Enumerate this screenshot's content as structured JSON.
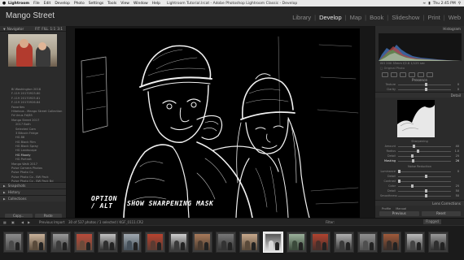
{
  "menubar": {
    "apple": "",
    "app_name": "Lightroom",
    "items": [
      "File",
      "Edit",
      "Develop",
      "Photo",
      "Settings",
      "Tools",
      "View",
      "Window",
      "Help"
    ],
    "window_title": "Lightroom Tutorial.lrcat - Adobe Photoshop Lightroom Classic - Develop",
    "clock": "Thu 2:45 PM"
  },
  "identity_plate": "Mango Street",
  "modules": {
    "items": [
      "Library",
      "Develop",
      "Map",
      "Book",
      "Slideshow",
      "Print",
      "Web"
    ],
    "active": "Develop"
  },
  "left_panel": {
    "navigator_title": "Navigator",
    "navigator_zoom": [
      "FIT",
      "FILL",
      "1:1",
      "3:1"
    ],
    "folders": [
      {
        "label": "Bl Washington 2018",
        "sub": false
      },
      {
        "label": "F-119 20170923.80",
        "sub": false
      },
      {
        "label": "F-119 20170925.81",
        "sub": false
      },
      {
        "label": "F-119 20170926.84",
        "sub": false
      },
      {
        "label": "Favorites",
        "sub": false
      },
      {
        "label": "Hilarious - Mango Street Collection",
        "sub": false
      },
      {
        "label": "Fd Unus Fd/85",
        "sub": false
      },
      {
        "label": "Mango Street 2017",
        "sub": false
      },
      {
        "label": "2017 Both",
        "sub": true
      },
      {
        "label": "Selected Cam",
        "sub": true
      },
      {
        "label": "3 Bitcoin Fridge",
        "sub": true
      },
      {
        "label": "HG 88",
        "sub": true
      },
      {
        "label": "HG Black Film",
        "sub": true
      },
      {
        "label": "HG Black Spray",
        "sub": true
      },
      {
        "label": "HG Landscape",
        "sub": true
      },
      {
        "label": "HG Moody",
        "sub": true,
        "selected": true
      },
      {
        "label": "HG Portrait",
        "sub": true
      },
      {
        "label": "Mango Walk 2017",
        "sub": false
      },
      {
        "label": "Pulse Camera Photos",
        "sub": false
      },
      {
        "label": "Pulse Photo Co",
        "sub": false
      },
      {
        "label": "Pulse Photo Co - BW Pack",
        "sub": false
      },
      {
        "label": "Pulse Photo Co - BW Pack Bd",
        "sub": false
      },
      {
        "label": "",
        "sub": false
      },
      {
        "label": "Color Palette",
        "sub": false
      }
    ],
    "sections": [
      "Snapshots",
      "History",
      "Collections"
    ],
    "buttons": [
      "Copy...",
      "Paste"
    ]
  },
  "overlay": {
    "option_line1": "OPTION",
    "option_line2": "/ ALT",
    "caption": "SHOW SHARPENING MASK"
  },
  "right_panel": {
    "histogram_title": "Histogram",
    "histogram_info": "ISO 200   35mm   f/2.8   1/125 sec",
    "original_photo": "Original Photo",
    "section_presence": "Presence",
    "texture_sliders": [
      {
        "label": "Texture",
        "value": "0"
      },
      {
        "label": "Clarity",
        "value": "0"
      }
    ],
    "detail_title": "Detail",
    "sharpening_title": "Sharpening",
    "sharpening_sliders": [
      {
        "label": "Amount",
        "value": "40",
        "level": 0.27
      },
      {
        "label": "Radius",
        "value": "1.0",
        "level": 0.35
      },
      {
        "label": "Detail",
        "value": "25",
        "level": 0.25
      },
      {
        "label": "Masking",
        "value": "26",
        "level": 0.26,
        "highlight": true
      }
    ],
    "noise_title": "Noise Reduction",
    "noise_sliders": [
      {
        "label": "Luminance",
        "value": "0",
        "level": 0.0
      },
      {
        "label": "Detail",
        "value": "",
        "level": 0.5
      },
      {
        "label": "Contrast",
        "value": "",
        "level": 0.0
      },
      {
        "label": "Color",
        "value": "25",
        "level": 0.25
      },
      {
        "label": "Detail",
        "value": "50",
        "level": 0.5
      },
      {
        "label": "Smoothness",
        "value": "50",
        "level": 0.5
      }
    ],
    "lens_title": "Lens Corrections",
    "profile_tabs": [
      "Profile",
      "Manual"
    ],
    "buttons": [
      "Previous",
      "Reset"
    ]
  },
  "toolbar": {
    "left_text": "Previous Import",
    "count_text": "30 of 537 photos / 1 selected / KGF_0111.CR2",
    "filter_label": "Filter:",
    "filter_value": "Flagged"
  },
  "filmstrip": {
    "count": 19,
    "selected_index": 11
  }
}
